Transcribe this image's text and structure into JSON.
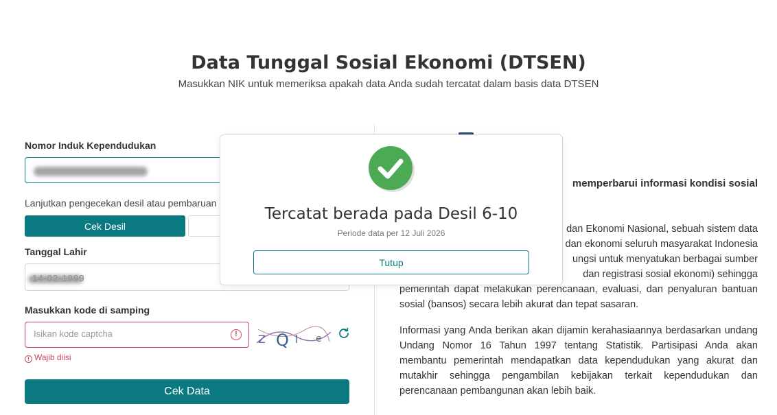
{
  "header": {
    "title": "Data Tunggal Sosial Ekonomi (DTSEN)",
    "subtitle": "Masukkan NIK untuk memeriksa apakah data Anda sudah tercatat dalam basis data DTSEN"
  },
  "form": {
    "nik_label": "Nomor Induk Kependudukan",
    "continue_hint": "Lanjutkan pengecekan desil atau pembaruan",
    "cek_desil_label": "Cek Desil",
    "dob_label": "Tanggal Lahir",
    "dob_value": "14-02-1999",
    "captcha_label": "Masukkan kode di samping",
    "captcha_placeholder": "Isikan kode captcha",
    "captcha_text": "Z Q l e",
    "required_text": "Wajib diisi",
    "submit_label": "Cek Data"
  },
  "info": {
    "heading_fragment": "memperbarui informasi kondisi sosial",
    "paragraph1_lines": [
      "dan Ekonomi Nasional, sebuah sistem data",
      "dan ekonomi seluruh masyarakat Indonesia",
      "ungsi untuk menyatukan berbagai sumber",
      "dan registrasi sosial ekonomi) sehingga",
      "pemerintah dapat melakukan perencanaan, evaluasi, dan penyaluran bantuan",
      "sosial (bansos) secara lebih akurat dan tepat sasaran."
    ],
    "paragraph2": "Informasi yang Anda berikan akan dijamin kerahasiaannya berdasarkan undang Undang Nomor 16 Tahun 1997 tentang Statistik. Partisipasi Anda akan membantu pemerintah mendapatkan data kependudukan yang akurat dan mutakhir sehingga pengambilan kebijakan terkait kependudukan dan perencanaan pembangunan akan lebih baik."
  },
  "modal": {
    "title": "Tercatat berada pada Desil 6-10",
    "subtitle": "Periode data per 12 Juli 2026",
    "close_label": "Tutup"
  },
  "colors": {
    "primary": "#0b7a80",
    "success": "#4caa55",
    "error": "#c9465a"
  }
}
